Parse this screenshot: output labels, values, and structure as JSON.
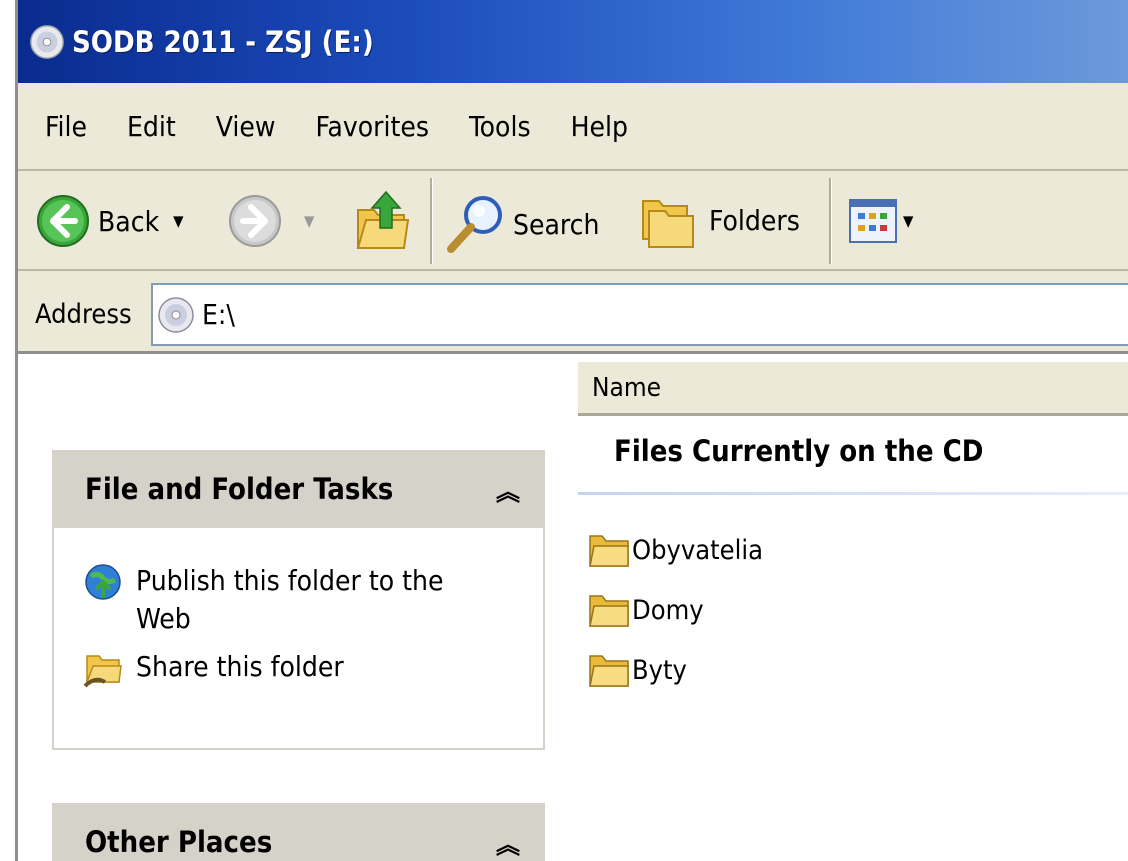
{
  "window": {
    "title": "SODB 2011 - ZSJ (E:)"
  },
  "menubar": {
    "items": [
      "File",
      "Edit",
      "View",
      "Favorites",
      "Tools",
      "Help"
    ]
  },
  "toolbar": {
    "back_label": "Back",
    "search_label": "Search",
    "folders_label": "Folders"
  },
  "address": {
    "label": "Address",
    "value": "E:\\"
  },
  "taskpane": {
    "file_folder_tasks": {
      "title": "File and Folder Tasks",
      "tasks": [
        {
          "label": "Publish this folder to the Web",
          "icon": "globe-publish-icon"
        },
        {
          "label": "Share this folder",
          "icon": "share-folder-icon"
        }
      ]
    },
    "other_places": {
      "title": "Other Places"
    }
  },
  "listview": {
    "column_name": "Name",
    "group_title": "Files Currently on the CD",
    "items": [
      "Obyvatelia",
      "Domy",
      "Byty"
    ]
  }
}
